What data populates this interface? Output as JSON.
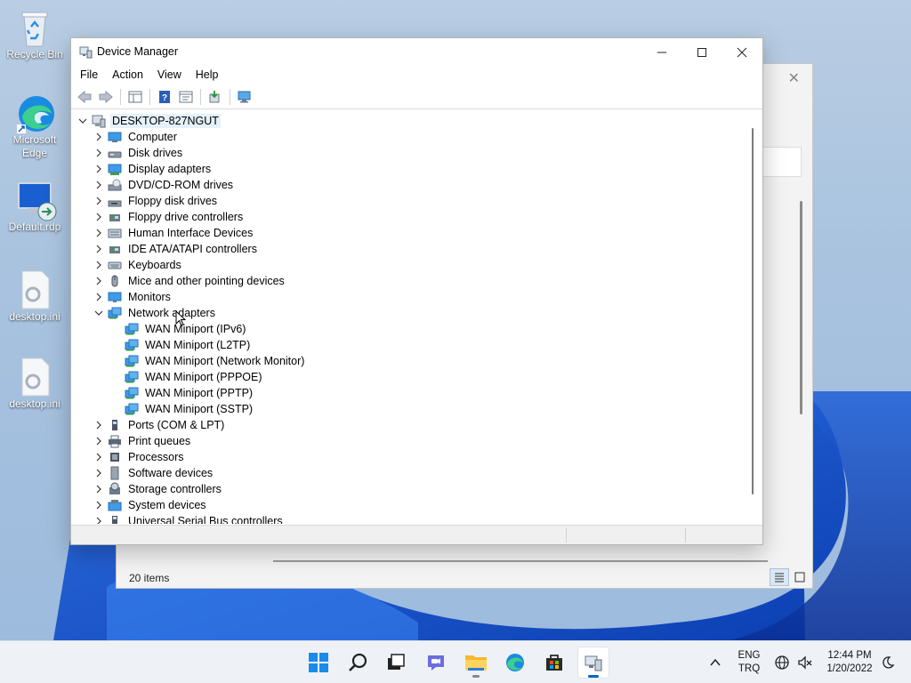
{
  "desktop": {
    "icons": [
      {
        "label": "Recycle Bin",
        "icon": "recycle-bin-icon"
      },
      {
        "label": "Microsoft Edge",
        "icon": "edge-icon"
      },
      {
        "label": "Default.rdp",
        "icon": "remote-desktop-icon"
      },
      {
        "label": "desktop.ini",
        "icon": "settings-file-icon"
      },
      {
        "label": "desktop.ini",
        "icon": "settings-file-icon"
      }
    ]
  },
  "background_window": {
    "status": "20 items"
  },
  "device_manager": {
    "title": "Device Manager",
    "menu": [
      "File",
      "Action",
      "View",
      "Help"
    ],
    "tree": {
      "root": "DESKTOP-827NGUT",
      "items": [
        {
          "label": "Computer",
          "icon": "computer-icon",
          "expanded": false
        },
        {
          "label": "Disk drives",
          "icon": "disk-drive-icon",
          "expanded": false
        },
        {
          "label": "Display adapters",
          "icon": "display-adapter-icon",
          "expanded": false
        },
        {
          "label": "DVD/CD-ROM drives",
          "icon": "dvd-drive-icon",
          "expanded": false
        },
        {
          "label": "Floppy disk drives",
          "icon": "floppy-drive-icon",
          "expanded": false
        },
        {
          "label": "Floppy drive controllers",
          "icon": "floppy-controller-icon",
          "expanded": false
        },
        {
          "label": "Human Interface Devices",
          "icon": "hid-icon",
          "expanded": false
        },
        {
          "label": "IDE ATA/ATAPI controllers",
          "icon": "ide-controller-icon",
          "expanded": false
        },
        {
          "label": "Keyboards",
          "icon": "keyboard-icon",
          "expanded": false
        },
        {
          "label": "Mice and other pointing devices",
          "icon": "mouse-icon",
          "expanded": false
        },
        {
          "label": "Monitors",
          "icon": "monitor-icon",
          "expanded": false
        },
        {
          "label": "Network adapters",
          "icon": "network-adapter-icon",
          "expanded": true,
          "children": [
            "WAN Miniport (IPv6)",
            "WAN Miniport (L2TP)",
            "WAN Miniport (Network Monitor)",
            "WAN Miniport (PPPOE)",
            "WAN Miniport (PPTP)",
            "WAN Miniport (SSTP)"
          ]
        },
        {
          "label": "Ports (COM & LPT)",
          "icon": "port-icon",
          "expanded": false
        },
        {
          "label": "Print queues",
          "icon": "printer-icon",
          "expanded": false
        },
        {
          "label": "Processors",
          "icon": "processor-icon",
          "expanded": false
        },
        {
          "label": "Software devices",
          "icon": "software-device-icon",
          "expanded": false
        },
        {
          "label": "Storage controllers",
          "icon": "storage-controller-icon",
          "expanded": false
        },
        {
          "label": "System devices",
          "icon": "system-device-icon",
          "expanded": false
        },
        {
          "label": "Universal Serial Bus controllers",
          "icon": "usb-icon",
          "expanded": false
        }
      ]
    }
  },
  "taskbar": {
    "apps": [
      "start-icon",
      "search-icon",
      "task-view-icon",
      "chat-icon",
      "file-explorer-icon",
      "edge-icon",
      "store-icon",
      "device-manager-icon"
    ],
    "language": {
      "line1": "ENG",
      "line2": "TRQ"
    },
    "time": "12:44 PM",
    "date": "1/20/2022"
  },
  "colors": {
    "accent": "#0067c0",
    "selection": "#e5f1fb",
    "taskbar": "#eef2f7"
  }
}
